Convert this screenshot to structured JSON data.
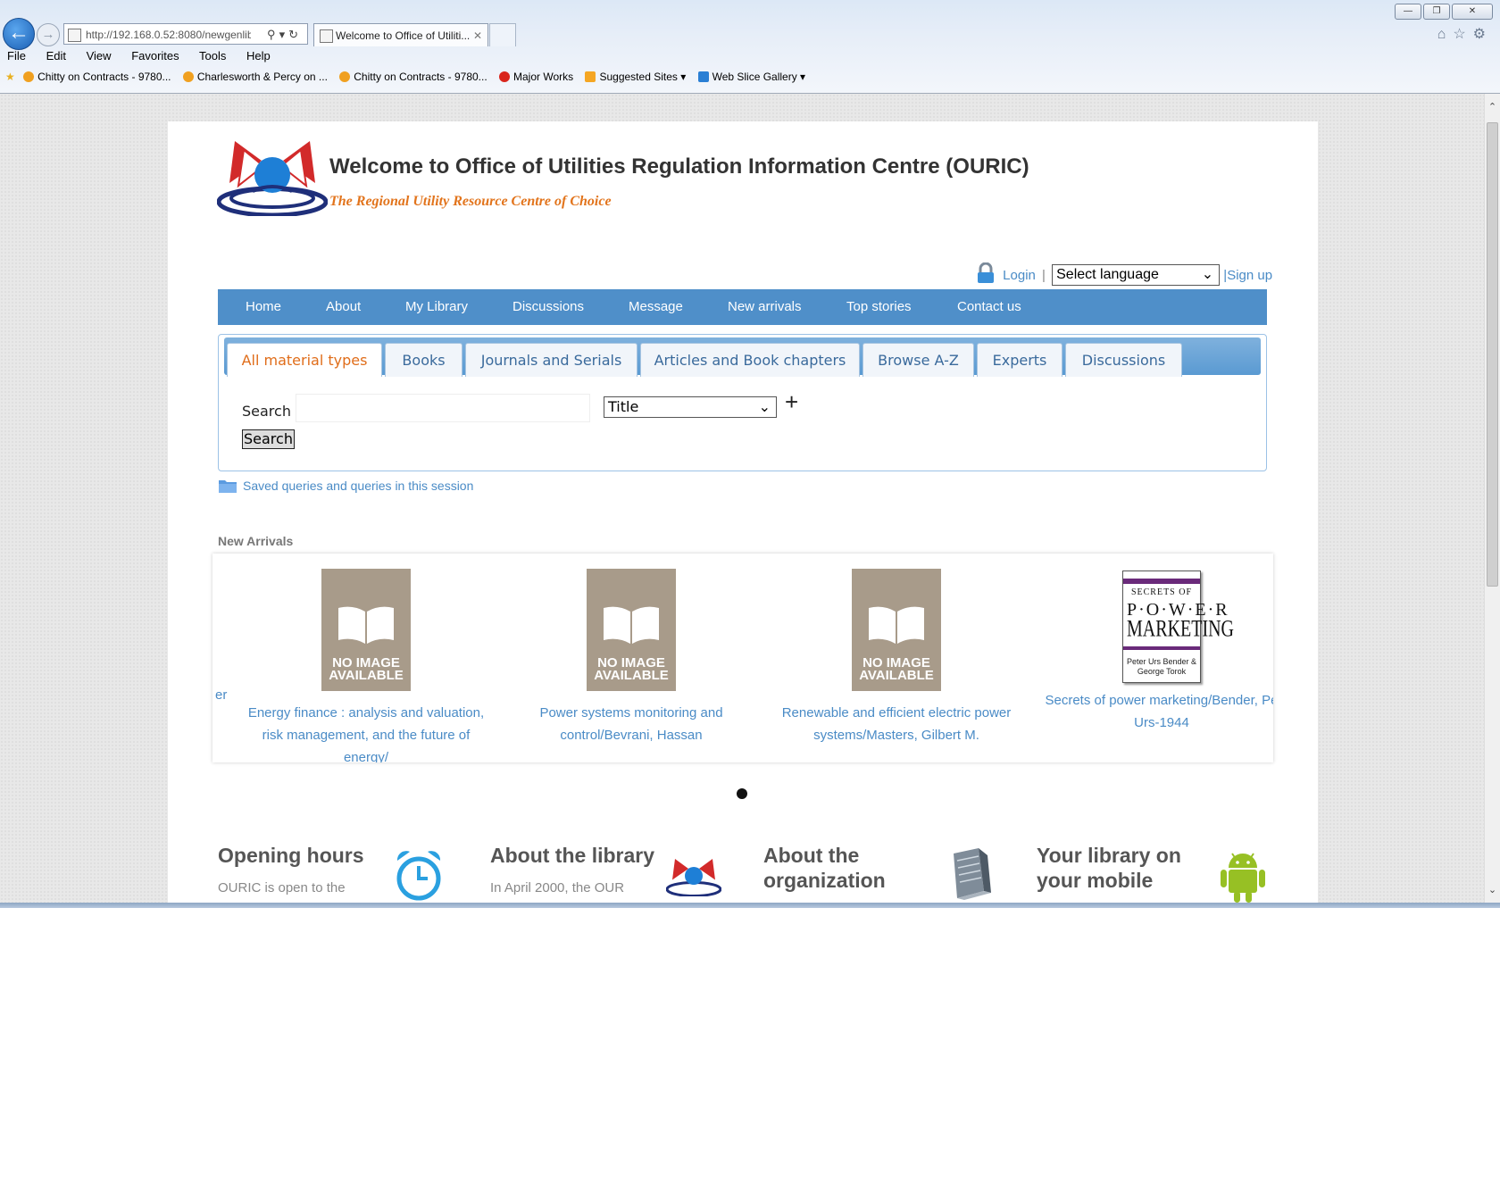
{
  "browser": {
    "url": "http://192.168.0.52:8080/newgenlibct",
    "tab_title": "Welcome to Office of Utiliti...",
    "tab_close": "✕",
    "menu": [
      "File",
      "Edit",
      "View",
      "Favorites",
      "Tools",
      "Help"
    ],
    "favorites": [
      {
        "label": "Chitty on Contracts - 9780...",
        "color": "#f0a020"
      },
      {
        "label": "Charlesworth & Percy on ...",
        "color": "#f0a020"
      },
      {
        "label": "Chitty on Contracts - 9780...",
        "color": "#f0a020"
      },
      {
        "label": "Major Works",
        "color": "#d9261c"
      },
      {
        "label": "Suggested Sites ▾",
        "color": "#f5a623"
      },
      {
        "label": "Web Slice Gallery ▾",
        "color": "#2a7fd4"
      }
    ]
  },
  "site": {
    "title": "Welcome to Office of Utilities Regulation Information Centre (OURIC)",
    "tagline": "The Regional Utility Resource Centre of Choice"
  },
  "user": {
    "login": "Login",
    "sep": "|",
    "language": "Select language",
    "signup": "|Sign up"
  },
  "nav": [
    "Home",
    "About",
    "My Library",
    "Discussions",
    "Message",
    "New arrivals",
    "Top stories",
    "Contact us"
  ],
  "search": {
    "tabs": [
      "All material types",
      "Books",
      "Journals and Serials",
      "Articles and Book chapters",
      "Browse A-Z",
      "Experts",
      "Discussions"
    ],
    "label": "Search",
    "field": "Title",
    "plus": "+",
    "button": "Search",
    "saved": "Saved queries and queries in this session"
  },
  "new_arrivals": {
    "heading": "New Arrivals",
    "no_image": [
      "NO IMAGE",
      "AVAILABLE"
    ],
    "prev_fragment": "er",
    "items": [
      {
        "title": "Energy finance : analysis and valuation, risk management, and the future of energy/"
      },
      {
        "title": "Power systems monitoring and control/Bevrani, Hassan"
      },
      {
        "title": "Renewable and efficient electric power systems/Masters, Gilbert M."
      },
      {
        "title": "Secrets of power marketing/Bender, Pe Urs-1944"
      }
    ],
    "cover": {
      "line1": "SECRETS OF",
      "line2": "P·O·W·E·R",
      "line3": "MARKETING",
      "authors": "Peter Urs Bender & George Torok"
    }
  },
  "info": [
    {
      "title": "Opening hours",
      "text": "OURIC is open to the"
    },
    {
      "title": "About the library",
      "text": "In April 2000, the OUR"
    },
    {
      "title": "About the organization",
      "text": ""
    },
    {
      "title": "Your library on your mobile",
      "text": ""
    }
  ]
}
